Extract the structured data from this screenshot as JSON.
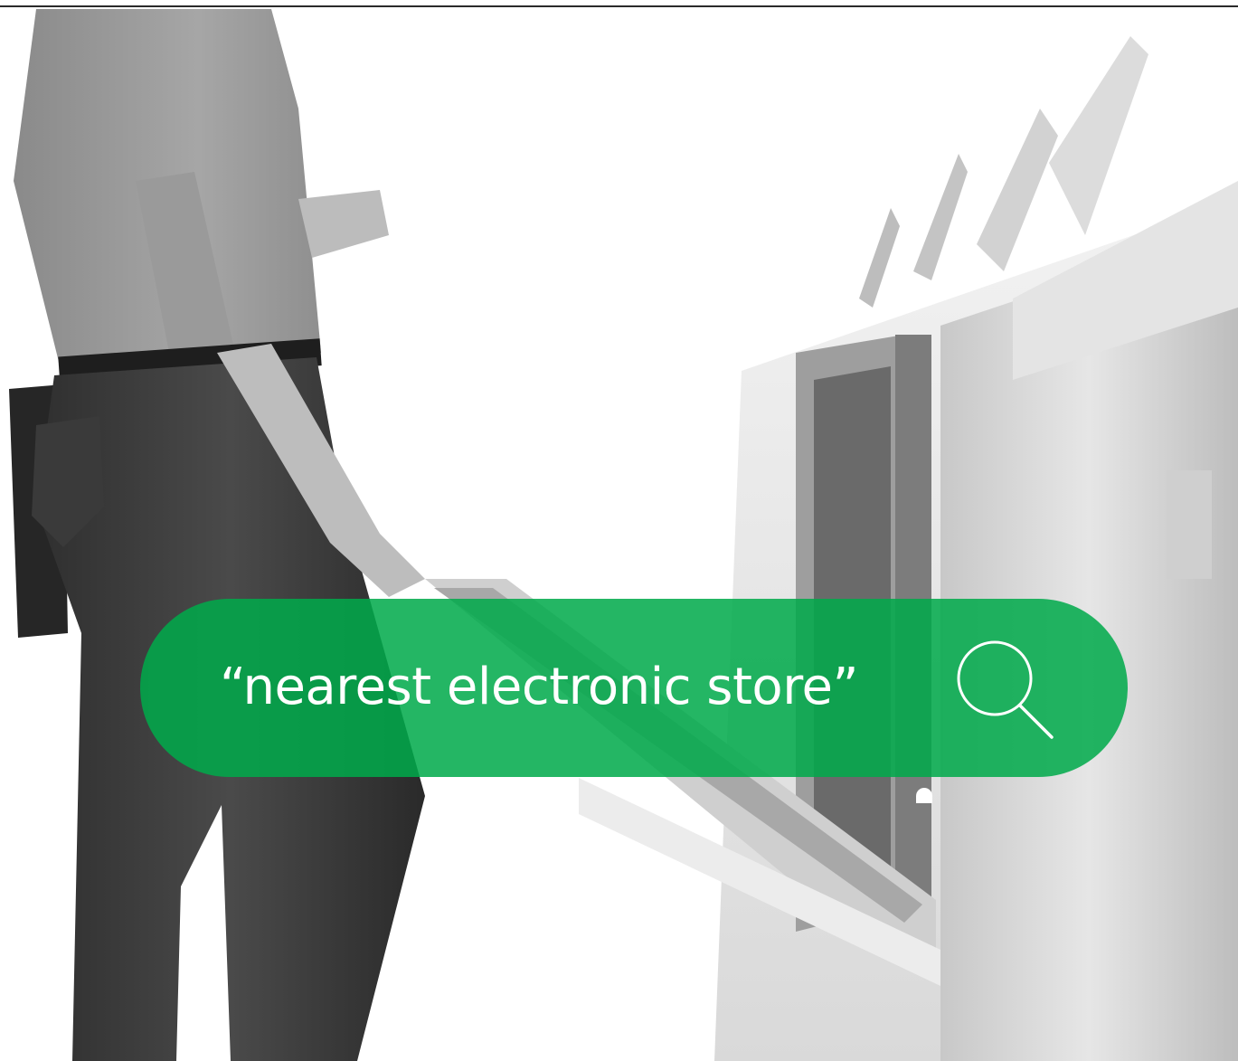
{
  "search": {
    "query": "“nearest electronic store”",
    "icon": "search-icon"
  },
  "colors": {
    "bar": "#00aa4b",
    "text": "#ffffff"
  }
}
